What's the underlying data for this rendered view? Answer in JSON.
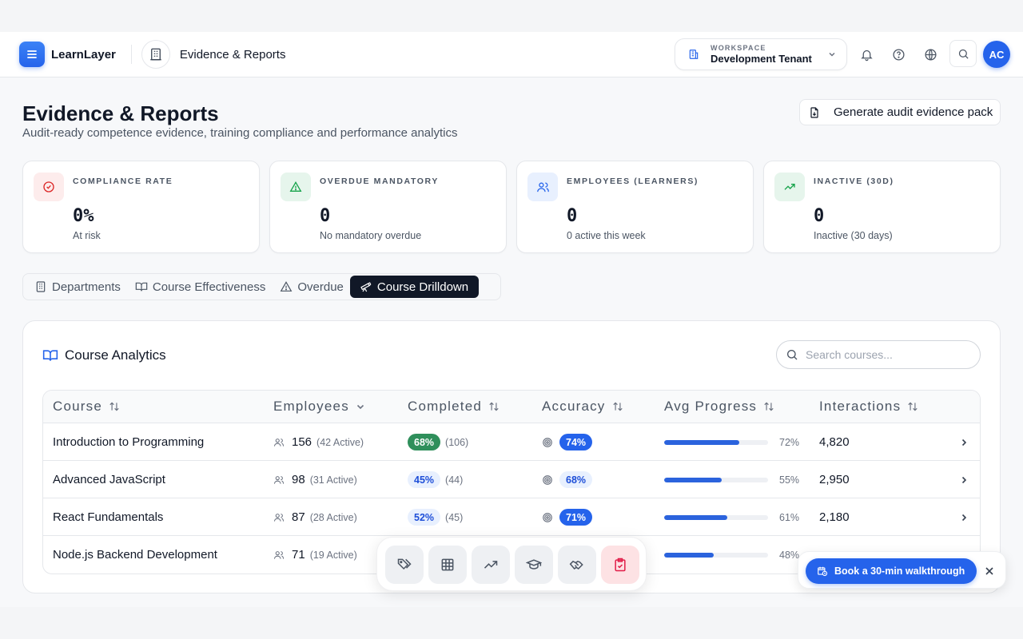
{
  "brand": {
    "name": "LearnLayer"
  },
  "breadcrumb": {
    "label": "Evidence & Reports"
  },
  "workspace": {
    "caption": "WORKSPACE",
    "name": "Development Tenant"
  },
  "user": {
    "initials": "AC"
  },
  "page": {
    "title": "Evidence & Reports",
    "subtitle": "Audit-ready competence evidence, training compliance and performance analytics",
    "generate_button": "Generate audit evidence pack"
  },
  "stats": [
    {
      "caption": "COMPLIANCE RATE",
      "value": "0%",
      "note": "At risk",
      "icon": "check-circle-icon",
      "color": "#dc2626"
    },
    {
      "caption": "OVERDUE MANDATORY",
      "value": "0",
      "note": "No mandatory overdue",
      "icon": "warning-triangle-icon",
      "color": "#16a34a"
    },
    {
      "caption": "EMPLOYEES (LEARNERS)",
      "value": "0",
      "note": "0 active this week",
      "icon": "users-icon",
      "color": "#2563eb"
    },
    {
      "caption": "INACTIVE (30D)",
      "value": "0",
      "note": "Inactive (30 days)",
      "icon": "trending-up-icon",
      "color": "#16a34a"
    }
  ],
  "tabs": [
    {
      "label": "Departments",
      "icon": "building-icon",
      "active": false
    },
    {
      "label": "Course Effectiveness",
      "icon": "book-icon",
      "active": false
    },
    {
      "label": "Overdue",
      "icon": "warning-triangle-icon",
      "active": false
    },
    {
      "label": "Course Drilldown",
      "icon": "telescope-icon",
      "active": true
    }
  ],
  "analytics": {
    "title": "Course Analytics",
    "search_placeholder": "Search courses...",
    "columns": [
      "Course",
      "Employees",
      "Completed",
      "Accuracy",
      "Avg Progress",
      "Interactions"
    ],
    "rows": [
      {
        "course": "Introduction to Programming",
        "employees": "156",
        "active": "(42 Active)",
        "completed": "68%",
        "completed_count": "(106)",
        "completed_style": "green",
        "accuracy": "74%",
        "accuracy_style": "blue",
        "progress": 72,
        "progress_label": "72%",
        "interactions": "4,820"
      },
      {
        "course": "Advanced JavaScript",
        "employees": "98",
        "active": "(31 Active)",
        "completed": "45%",
        "completed_count": "(44)",
        "completed_style": "light",
        "accuracy": "68%",
        "accuracy_style": "light",
        "progress": 55,
        "progress_label": "55%",
        "interactions": "2,950"
      },
      {
        "course": "React Fundamentals",
        "employees": "87",
        "active": "(28 Active)",
        "completed": "52%",
        "completed_count": "(45)",
        "completed_style": "light",
        "accuracy": "71%",
        "accuracy_style": "blue",
        "progress": 61,
        "progress_label": "61%",
        "interactions": "2,180"
      },
      {
        "course": "Node.js Backend Development",
        "employees": "71",
        "active": "(19 Active)",
        "completed": "",
        "completed_count": "",
        "completed_style": "light",
        "accuracy": "",
        "accuracy_style": "light",
        "progress": 48,
        "progress_label": "48%",
        "interactions": ""
      }
    ]
  },
  "dock": [
    "tags-icon",
    "table-icon",
    "trending-up-icon",
    "graduation-cap-icon",
    "handshake-icon",
    "clipboard-check-icon"
  ],
  "toast": {
    "label": "Book a 30-min walkthrough"
  }
}
